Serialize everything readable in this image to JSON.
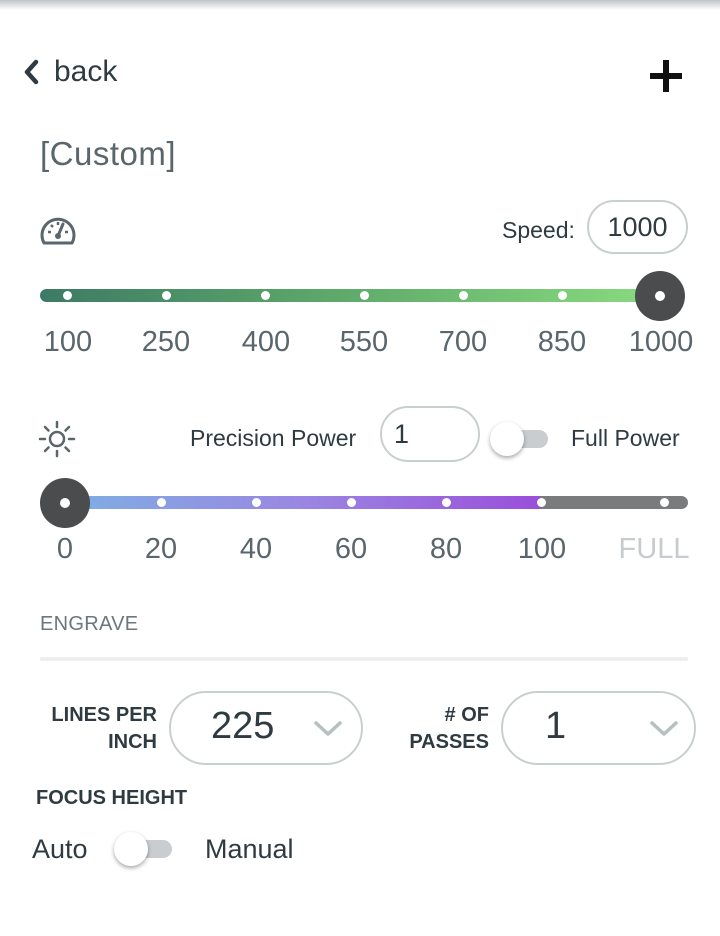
{
  "header": {
    "back_label": "back",
    "add_icon": "plus-icon",
    "back_icon": "chevron-left-icon"
  },
  "title": "[Custom]",
  "speed": {
    "icon": "speedometer-icon",
    "label": "Speed:",
    "value": "1000",
    "slider_value": 1000,
    "ticks": [
      "100",
      "250",
      "400",
      "550",
      "700",
      "850",
      "1000"
    ],
    "track_colors": [
      "#3d7a64",
      "#8ddf80"
    ]
  },
  "power": {
    "icon": "sun-icon",
    "precision_label": "Precision Power",
    "value": "1",
    "full_power_label": "Full Power",
    "full_power_on": false,
    "slider_value": 0,
    "ticks": [
      "0",
      "20",
      "40",
      "60",
      "80",
      "100",
      "FULL"
    ],
    "track_colors": [
      "#7bb3e3",
      "#9a4fd9",
      "#7a7b7c"
    ]
  },
  "engrave": {
    "section_label": "ENGRAVE",
    "lines_per_inch": {
      "label_line1": "LINES PER",
      "label_line2": "INCH",
      "value": "225"
    },
    "passes": {
      "label_line1": "# OF",
      "label_line2": "PASSES",
      "value": "1"
    },
    "chevron_icon": "chevron-down-icon"
  },
  "focus": {
    "label": "FOCUS HEIGHT",
    "auto_label": "Auto",
    "manual_label": "Manual",
    "manual_on": false
  }
}
